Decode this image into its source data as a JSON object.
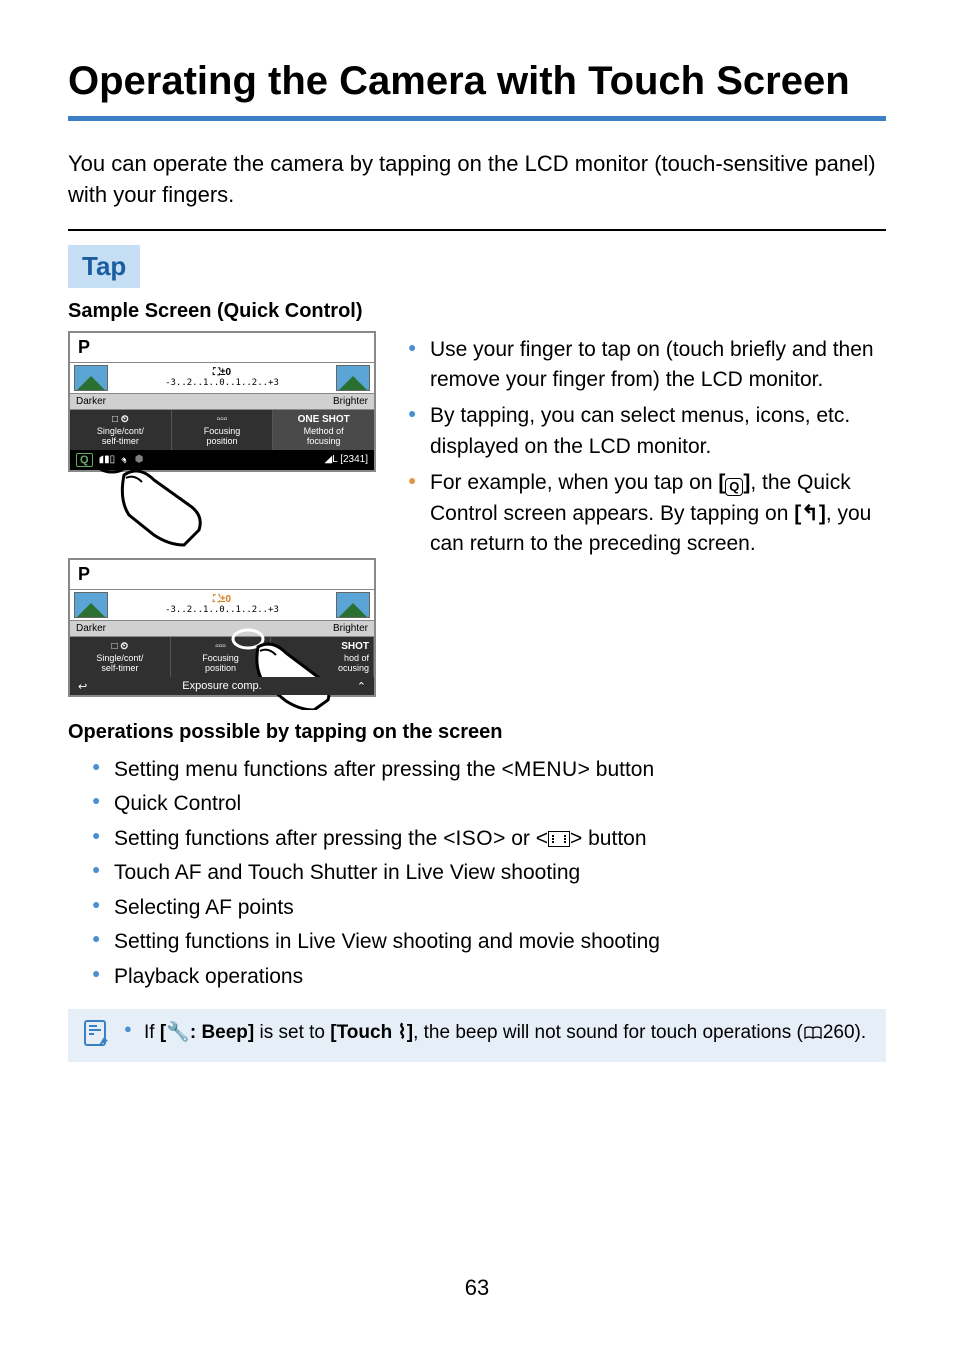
{
  "title": "Operating the Camera with Touch Screen",
  "intro": "You can operate the camera by tapping on the LCD monitor (touch-sensitive panel) with your fingers.",
  "section": {
    "heading": "Tap",
    "subheading": "Sample Screen (Quick Control)"
  },
  "bullets_right": [
    "Use your finger to tap on (touch briefly and then remove your finger from) the LCD monitor.",
    "By tapping, you can select menus, icons, etc. displayed on the LCD monitor.",
    "For example, when you tap on [Q], the Quick Control screen appears. By tapping on [↩], you can return to the preceding screen."
  ],
  "bullet3_parts": {
    "p1": "For example, when you tap on ",
    "p2": ", the Quick Control screen appears. By tapping on ",
    "p3": ", you can return to the preceding screen."
  },
  "screen1": {
    "mode": "P",
    "exp_label": "±0",
    "scale": "-3..2..1..0..1..2..+3",
    "darker": "Darker",
    "brighter": "Brighter",
    "btn1_icon": "□ ⏲",
    "btn1_l1": "Single/cont/",
    "btn1_l2": "self-timer",
    "btn2_icon": "▫▫▫",
    "btn2_l1": "Focusing",
    "btn2_l2": "position",
    "btn3_title": "ONE SHOT",
    "btn3_l1": "Method of",
    "btn3_l2": "focusing",
    "footer_q": "Q",
    "footer_batt": "▮▮▯",
    "footer_wifi": "📶",
    "footer_bt": "🅱",
    "footer_right": "◢L [2341]"
  },
  "screen2": {
    "mode": "P",
    "exp_label": "±0",
    "scale": "-3..2..1..0..1..2..+3",
    "darker": "Darker",
    "brighter": "Brighter",
    "btn1_icon": "□ ⏲",
    "btn1_l1": "Single/cont/",
    "btn1_l2": "self-timer",
    "btn2_icon": "▫▫▫",
    "btn2_l1": "Focusing",
    "btn2_l2": "position",
    "btn3_title_partial": "SHOT",
    "btn3_l1_partial": "hod of",
    "btn3_l2_partial": "ocusing",
    "footer_label": "Exposure comp.",
    "back": "↩",
    "up": "⌃"
  },
  "ops_heading": "Operations possible by tapping on the screen",
  "ops_list": {
    "item1_p1": "Setting menu functions after pressing the <",
    "item1_menu": "MENU",
    "item1_p2": "> button",
    "item2": "Quick Control",
    "item3_p1": "Setting functions after pressing the <",
    "item3_iso": "ISO",
    "item3_p2": "> or <",
    "item3_p3": "> button",
    "item4": "Touch AF and Touch Shutter in Live View shooting",
    "item5": "Selecting AF points",
    "item6": "Setting functions in Live View shooting and movie shooting",
    "item7": "Playback operations"
  },
  "note": {
    "p1": "If ",
    "bold1": "[🔧: Beep]",
    "p2": " is set to ",
    "bold2": "[Touch 🔕]",
    "p3": ", the beep will not sound for touch operations (",
    "page_ref": "260",
    "p4": ")."
  },
  "page_number": "63"
}
